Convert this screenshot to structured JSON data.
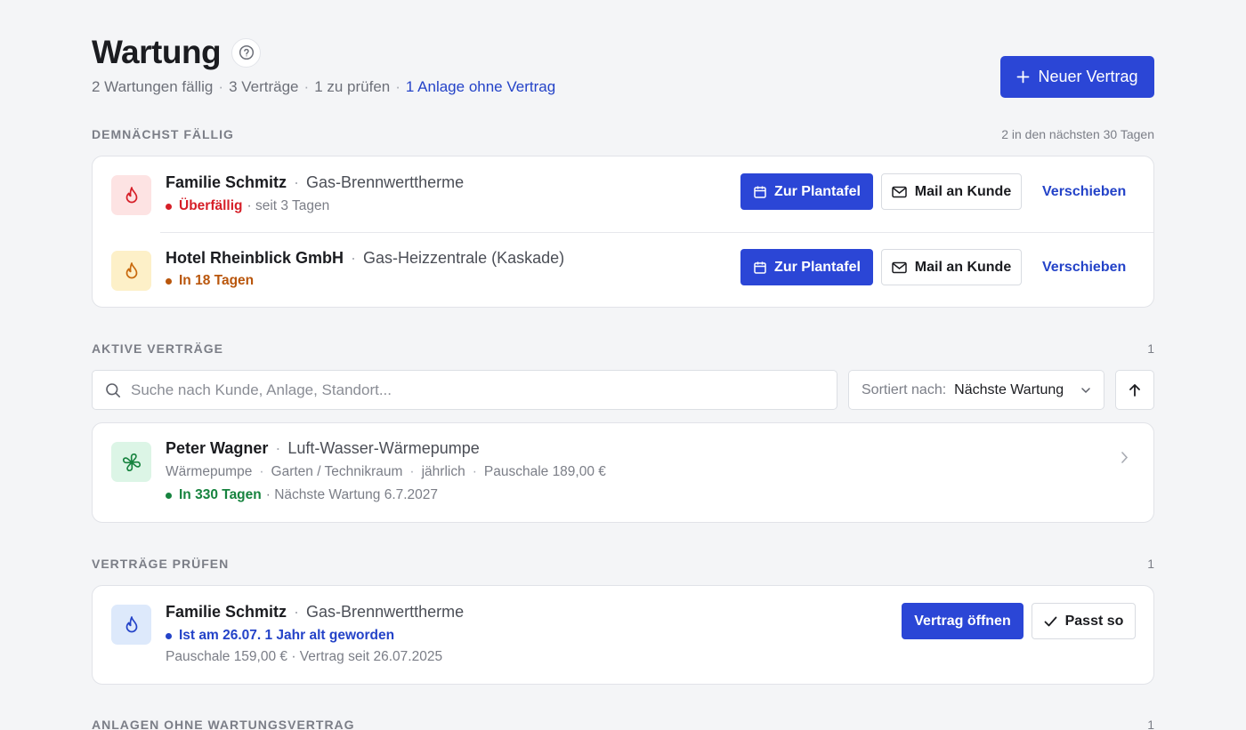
{
  "header": {
    "title": "Wartung",
    "summary": [
      "2 Wartungen fällig",
      "3 Verträge",
      "1 zu prüfen"
    ],
    "summary_link": "1 Anlage ohne Vertrag",
    "new_button": "Neuer Vertrag"
  },
  "due": {
    "label": "DEMNÄCHST FÄLLIG",
    "meta": "2 in den nächsten 30 Tagen",
    "items": [
      {
        "name": "Familie Schmitz",
        "device": "Gas-Brennwerttherme",
        "status": "Überfällig",
        "status_extra": "· seit 3 Tagen",
        "status_color": "#d61f28",
        "icon": "flame-icon",
        "btn_plan": "Zur Plantafel",
        "btn_mail": "Mail an Kunde",
        "btn_move": "Verschieben"
      },
      {
        "name": "Hotel Rheinblick GmbH",
        "device": "Gas-Heizzentrale (Kaskade)",
        "status": "In 18 Tagen",
        "status_extra": "",
        "status_color": "#b9560c",
        "icon": "flame-icon",
        "btn_plan": "Zur Plantafel",
        "btn_mail": "Mail an Kunde",
        "btn_move": "Verschieben"
      }
    ]
  },
  "active": {
    "label": "AKTIVE VERTRÄGE",
    "count": "1",
    "search_placeholder": "Suche nach Kunde, Anlage, Standort...",
    "sort_label": "Sortiert nach:",
    "sort_value": "Nächste Wartung",
    "items": [
      {
        "name": "Peter Wagner",
        "device": "Luft-Wasser-Wärmepumpe",
        "meta": [
          "Wärmepumpe",
          "Garten / Technikraum",
          "jährlich",
          "Pauschale 189,00 €"
        ],
        "status": "In 330 Tagen",
        "status_extra": "· Nächste Wartung 6.7.2027",
        "status_color": "#17833f",
        "icon": "fan-icon"
      }
    ]
  },
  "review": {
    "label": "VERTRÄGE PRÜFEN",
    "count": "1",
    "items": [
      {
        "name": "Familie Schmitz",
        "device": "Gas-Brennwerttherme",
        "status": "Ist am 26.07. 1 Jahr alt geworden",
        "status_color": "#2443c8",
        "detail": "Pauschale 159,00 € · Vertrag seit 26.07.2025",
        "icon": "flame-icon",
        "btn_open": "Vertrag öffnen",
        "btn_ok": "Passt so"
      }
    ]
  },
  "no_contract": {
    "label": "ANLAGEN OHNE WARTUNGSVERTRAG",
    "count": "1"
  },
  "colors": {
    "accent": "#2b46d6",
    "overdue": "#d61f28",
    "soon": "#b9560c",
    "ok": "#17833f",
    "info": "#2443c8"
  }
}
